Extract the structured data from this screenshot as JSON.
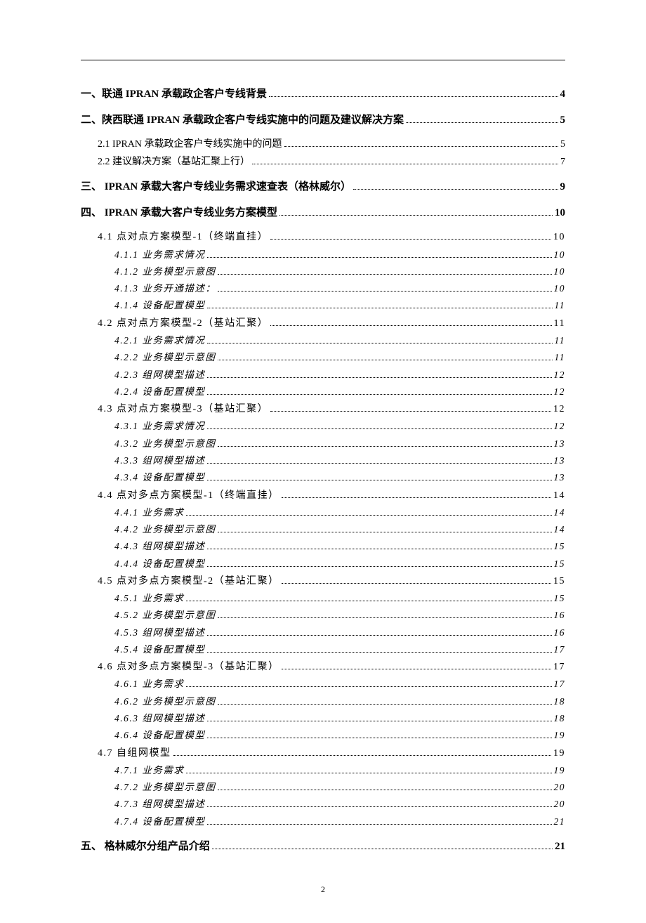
{
  "page_number": "2",
  "toc": [
    {
      "level": 1,
      "cls": "lvl1",
      "label": "一、联通 IPRAN 承载政企客户专线背景",
      "page": "4"
    },
    {
      "level": 1,
      "cls": "lvl1",
      "label": "二、陕西联通 IPRAN 承载政企客户专线实施中的问题及建议解决方案",
      "page": "5"
    },
    {
      "level": 2,
      "cls": "lvl2",
      "label": "2.1  IPRAN 承载政企客户专线实施中的问题",
      "page": "5"
    },
    {
      "level": 2,
      "cls": "lvl2",
      "label": "2.2 建议解决方案（基站汇聚上行）",
      "page": "7"
    },
    {
      "level": 1,
      "cls": "lvl1",
      "label": "三、     IPRAN 承载大客户专线业务需求速查表（格林威尔）",
      "page": "9"
    },
    {
      "level": 1,
      "cls": "lvl1",
      "label": "四、     IPRAN 承载大客户专线业务方案模型",
      "page": "10"
    },
    {
      "level": 2,
      "cls": "sec4-sub",
      "label": "4.1 点对点方案模型-1（终端直挂）",
      "page": "10"
    },
    {
      "level": 3,
      "cls": "sec4-subsub",
      "label": "4.1.1 业务需求情况",
      "page": "10"
    },
    {
      "level": 3,
      "cls": "sec4-subsub",
      "label": "4.1.2 业务模型示意图",
      "page": "10"
    },
    {
      "level": 3,
      "cls": "sec4-subsub",
      "label": "4.1.3 业务开通描述：",
      "page": "10"
    },
    {
      "level": 3,
      "cls": "sec4-subsub",
      "label": "4.1.4 设备配置模型",
      "page": "11"
    },
    {
      "level": 2,
      "cls": "sec4-sub",
      "label": "4.2 点对点方案模型-2（基站汇聚）",
      "page": "11"
    },
    {
      "level": 3,
      "cls": "sec4-subsub",
      "label": "4.2.1 业务需求情况",
      "page": "11"
    },
    {
      "level": 3,
      "cls": "sec4-subsub",
      "label": "4.2.2 业务模型示意图",
      "page": "11"
    },
    {
      "level": 3,
      "cls": "sec4-subsub",
      "label": "4.2.3 组网模型描述",
      "page": "12"
    },
    {
      "level": 3,
      "cls": "sec4-subsub",
      "label": "4.2.4 设备配置模型",
      "page": "12"
    },
    {
      "level": 2,
      "cls": "sec4-sub",
      "label": "4.3 点对点方案模型-3（基站汇聚）",
      "page": "12"
    },
    {
      "level": 3,
      "cls": "sec4-subsub",
      "label": "4.3.1 业务需求情况",
      "page": "12"
    },
    {
      "level": 3,
      "cls": "sec4-subsub",
      "label": "4.3.2 业务模型示意图",
      "page": "13"
    },
    {
      "level": 3,
      "cls": "sec4-subsub",
      "label": "4.3.3 组网模型描述",
      "page": "13"
    },
    {
      "level": 3,
      "cls": "sec4-subsub",
      "label": "4.3.4 设备配置模型",
      "page": "13"
    },
    {
      "level": 2,
      "cls": "sec4-sub",
      "label": "4.4 点对多点方案模型-1（终端直挂）",
      "page": "14"
    },
    {
      "level": 3,
      "cls": "sec4-subsub",
      "label": "4.4.1 业务需求",
      "page": "14"
    },
    {
      "level": 3,
      "cls": "sec4-subsub",
      "label": "4.4.2 业务模型示意图",
      "page": "14"
    },
    {
      "level": 3,
      "cls": "sec4-subsub",
      "label": "4.4.3 组网模型描述",
      "page": "15"
    },
    {
      "level": 3,
      "cls": "sec4-subsub",
      "label": "4.4.4 设备配置模型",
      "page": "15"
    },
    {
      "level": 2,
      "cls": "sec4-sub",
      "label": "4.5 点对多点方案模型-2（基站汇聚）",
      "page": "15"
    },
    {
      "level": 3,
      "cls": "sec4-subsub",
      "label": "4.5.1 业务需求",
      "page": "15"
    },
    {
      "level": 3,
      "cls": "sec4-subsub",
      "label": "4.5.2 业务模型示意图",
      "page": "16"
    },
    {
      "level": 3,
      "cls": "sec4-subsub",
      "label": "4.5.3 组网模型描述",
      "page": "16"
    },
    {
      "level": 3,
      "cls": "sec4-subsub",
      "label": "4.5.4 设备配置模型",
      "page": "17"
    },
    {
      "level": 2,
      "cls": "sec4-sub",
      "label": "4.6 点对多点方案模型-3（基站汇聚）",
      "page": "17"
    },
    {
      "level": 3,
      "cls": "sec4-subsub",
      "label": "4.6.1 业务需求",
      "page": "17"
    },
    {
      "level": 3,
      "cls": "sec4-subsub",
      "label": "4.6.2 业务模型示意图",
      "page": "18"
    },
    {
      "level": 3,
      "cls": "sec4-subsub",
      "label": "4.6.3 组网模型描述",
      "page": "18"
    },
    {
      "level": 3,
      "cls": "sec4-subsub",
      "label": "4.6.4 设备配置模型",
      "page": "19"
    },
    {
      "level": 2,
      "cls": "sec4-sub",
      "label": "4.7 自组网模型",
      "page": "19"
    },
    {
      "level": 3,
      "cls": "sec4-subsub",
      "label": "4.7.1 业务需求",
      "page": "19"
    },
    {
      "level": 3,
      "cls": "sec4-subsub",
      "label": "4.7.2 业务模型示意图",
      "page": "20"
    },
    {
      "level": 3,
      "cls": "sec4-subsub",
      "label": "4.7.3 组网模型描述",
      "page": "20"
    },
    {
      "level": 3,
      "cls": "sec4-subsub",
      "label": "4.7.4 设备配置模型",
      "page": "21"
    },
    {
      "level": 1,
      "cls": "lvl1",
      "label": "五、     格林威尔分组产品介绍",
      "page": "21"
    }
  ]
}
